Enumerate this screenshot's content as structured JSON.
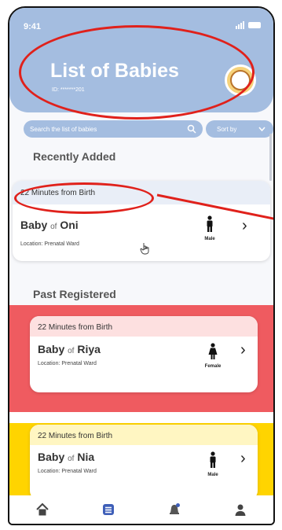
{
  "status": {
    "time": "9:41"
  },
  "header": {
    "title": "List of Babies",
    "subtitle": "ID: *******201"
  },
  "search": {
    "placeholder": "Search the list of babies",
    "sort_label": "Sort by"
  },
  "sections": {
    "recent": "Recently Added",
    "past": "Past Registered"
  },
  "recent_card": {
    "time": "22 Minutes from Birth",
    "baby": "Baby",
    "of": "of",
    "parent": "Oni",
    "location": "Location: Prenatal Ward",
    "gender": "Male"
  },
  "past_cards": [
    {
      "time": "22 Minutes from Birth",
      "baby": "Baby",
      "of": "of",
      "parent": "Riya",
      "location": "Location: Prenatal Ward",
      "gender": "Female",
      "band_color": "#ef5b60",
      "header_color": "#fde0e0"
    },
    {
      "time": "22 Minutes from Birth",
      "baby": "Baby",
      "of": "of",
      "parent": "Nia",
      "location": "Location: Prenatal Ward",
      "gender": "Male",
      "band_color": "#ffd400",
      "header_color": "#fff6c2"
    }
  ],
  "nav": [
    "home-icon",
    "list-icon",
    "notification-icon",
    "profile-icon"
  ],
  "colors": {
    "header": "#a4bde0",
    "annotation": "#e0211b"
  }
}
